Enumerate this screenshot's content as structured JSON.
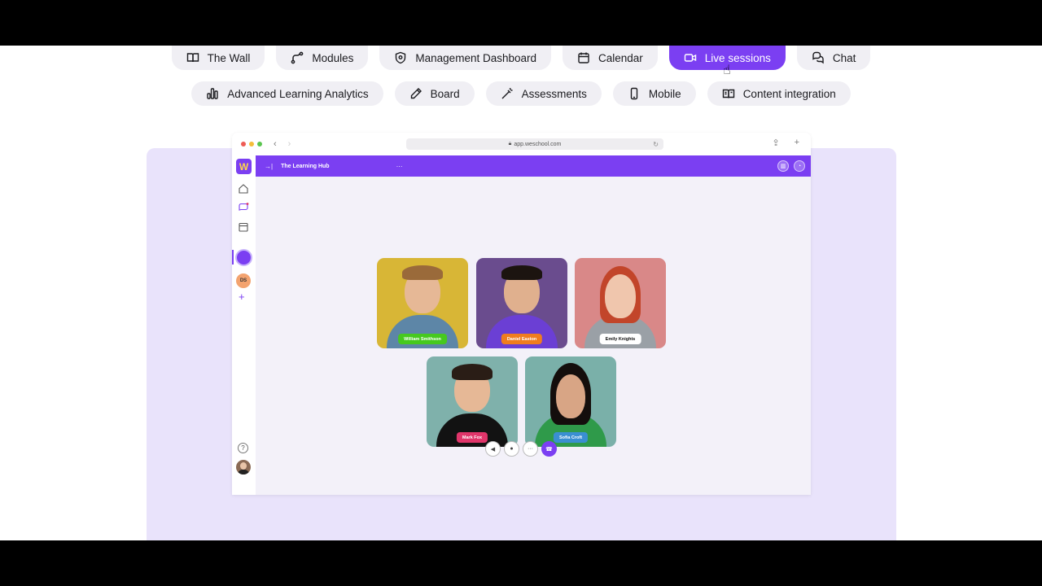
{
  "nav_tabs": {
    "row1": [
      {
        "label": "The Wall",
        "icon": "book-open-icon",
        "active": false
      },
      {
        "label": "Modules",
        "icon": "path-icon",
        "active": false
      },
      {
        "label": "Management Dashboard",
        "icon": "shield-icon",
        "active": false
      },
      {
        "label": "Calendar",
        "icon": "calendar-icon",
        "active": false
      },
      {
        "label": "Live sessions",
        "icon": "video-camera-icon",
        "active": true
      },
      {
        "label": "Chat",
        "icon": "chat-bubbles-icon",
        "active": false
      }
    ],
    "row2": [
      {
        "label": "Advanced Learning Analytics",
        "icon": "bar-chart-icon",
        "active": false
      },
      {
        "label": "Board",
        "icon": "pencil-icon",
        "active": false
      },
      {
        "label": "Assessments",
        "icon": "wand-icon",
        "active": false
      },
      {
        "label": "Mobile",
        "icon": "mobile-phone-icon",
        "active": false
      },
      {
        "label": "Content integration",
        "icon": "book-icon",
        "active": false
      }
    ]
  },
  "browser": {
    "url": "app.weschool.com"
  },
  "app": {
    "logo_letter": "W",
    "space_title": "The Learning Hub",
    "more_label": "···",
    "sidebar_badge": "DS",
    "help_label": "?",
    "plus_label": "+"
  },
  "participants": [
    {
      "name": "William Smithson",
      "tag_color": "#46c91e",
      "bg": "#d8b636"
    },
    {
      "name": "Daniel Easton",
      "tag_color": "#f07d1e",
      "bg": "#6a4c8e"
    },
    {
      "name": "Emily Knights",
      "tag_color": "#ffffff",
      "bg": "#d98888"
    },
    {
      "name": "Mark Fox",
      "tag_color": "#e0356a",
      "bg": "#7fb1ab"
    },
    {
      "name": "Sofia Croft",
      "tag_color": "#3a8fd1",
      "bg": "#7ab0a9"
    }
  ],
  "colors": {
    "accent": "#7b3ff2",
    "stage_bg": "#e9e3fb"
  }
}
